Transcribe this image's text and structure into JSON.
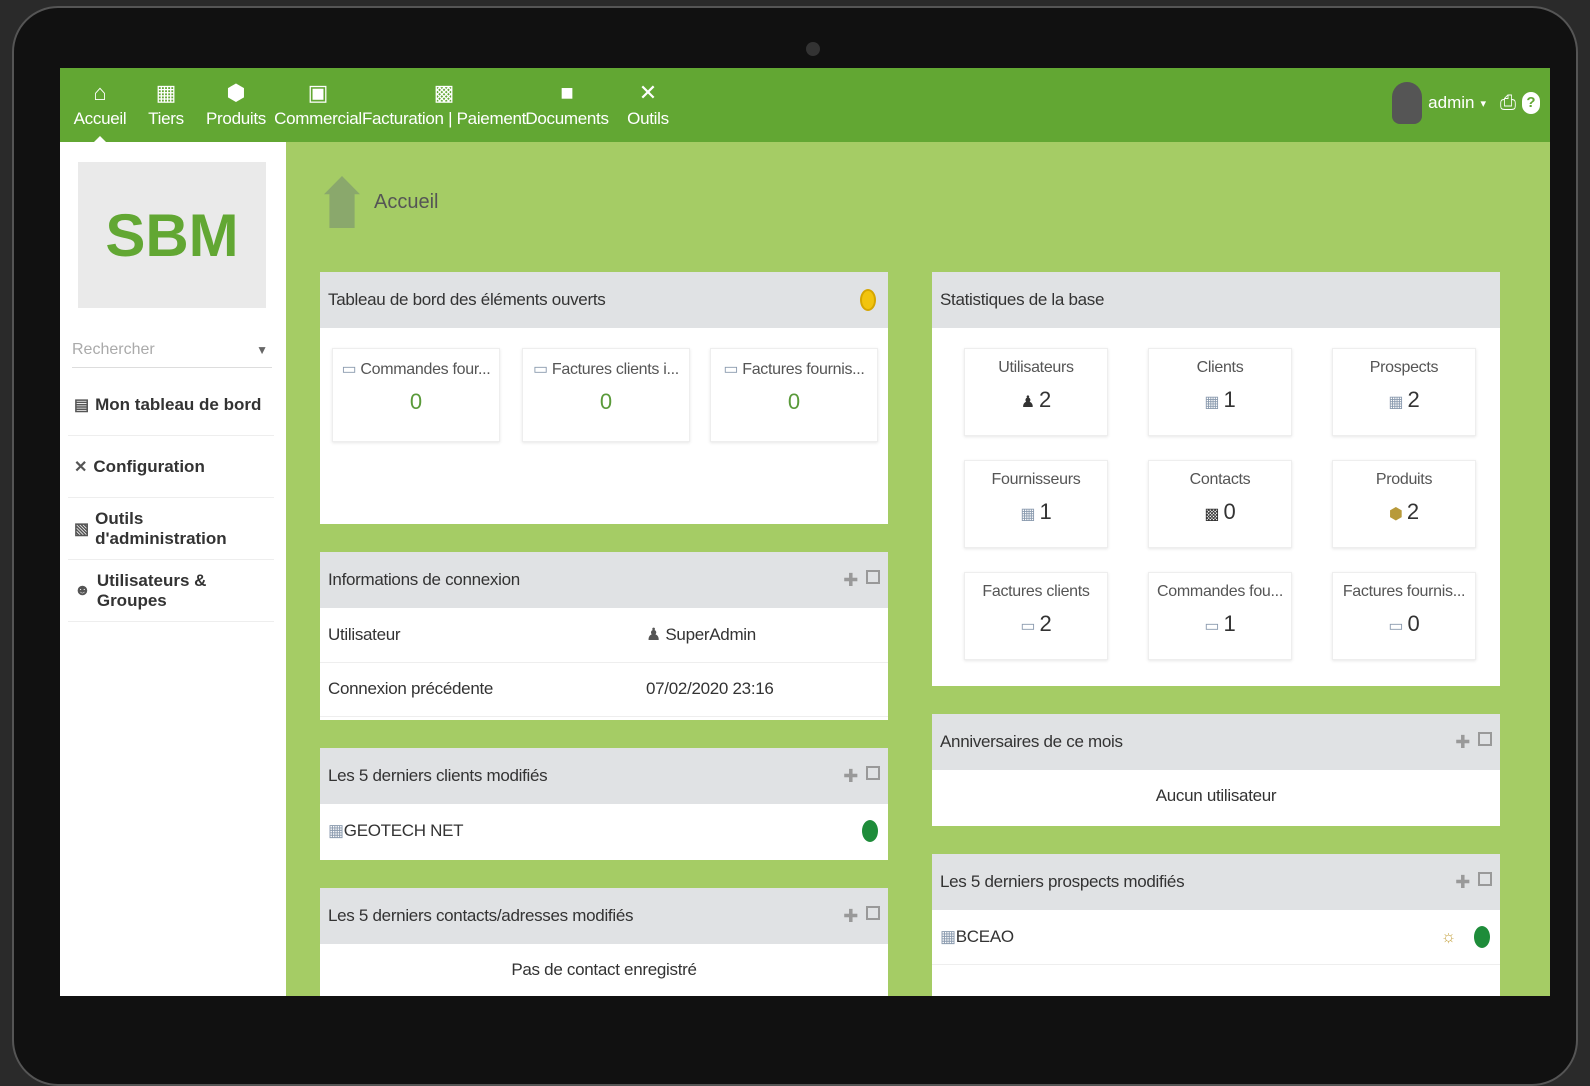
{
  "logo_text": "SBM",
  "nav": [
    {
      "label": "Accueil",
      "icon": "home-icon"
    },
    {
      "label": "Tiers",
      "icon": "building-icon"
    },
    {
      "label": "Produits",
      "icon": "cube-icon"
    },
    {
      "label": "Commercial",
      "icon": "briefcase-icon"
    },
    {
      "label": "Facturation | Paiement",
      "icon": "money-icon"
    },
    {
      "label": "Documents",
      "icon": "folder-icon"
    },
    {
      "label": "Outils",
      "icon": "wrench-icon"
    }
  ],
  "user": {
    "name": "admin"
  },
  "search": {
    "placeholder": "Rechercher"
  },
  "sidebar": [
    {
      "label": "Mon tableau de bord",
      "icon": "chart-icon"
    },
    {
      "label": "Configuration",
      "icon": "wrench-icon"
    },
    {
      "label": "Outils d'administration",
      "icon": "server-icon"
    },
    {
      "label": "Utilisateurs & Groupes",
      "icon": "users-icon"
    }
  ],
  "page_title": "Accueil",
  "dashboard": {
    "title": "Tableau de bord des éléments ouverts",
    "boxes": [
      {
        "label": "Commandes four...",
        "value": "0"
      },
      {
        "label": "Factures clients i...",
        "value": "0"
      },
      {
        "label": "Factures fournis...",
        "value": "0"
      }
    ]
  },
  "login_info": {
    "title": "Informations de connexion",
    "rows": [
      {
        "label": "Utilisateur",
        "value": "SuperAdmin"
      },
      {
        "label": "Connexion précédente",
        "value": "07/02/2020 23:16"
      }
    ]
  },
  "last_clients": {
    "title": "Les 5 derniers clients modifiés",
    "items": [
      "GEOTECH NET"
    ]
  },
  "last_contacts": {
    "title": "Les 5 derniers contacts/adresses modifiés",
    "empty": "Pas de contact enregistré"
  },
  "stats": {
    "title": "Statistiques de la base",
    "boxes": [
      {
        "label": "Utilisateurs",
        "value": "2"
      },
      {
        "label": "Clients",
        "value": "1"
      },
      {
        "label": "Prospects",
        "value": "2"
      },
      {
        "label": "Fournisseurs",
        "value": "1"
      },
      {
        "label": "Contacts",
        "value": "0"
      },
      {
        "label": "Produits",
        "value": "2"
      },
      {
        "label": "Factures clients",
        "value": "2"
      },
      {
        "label": "Commandes fou...",
        "value": "1"
      },
      {
        "label": "Factures fournis...",
        "value": "0"
      }
    ]
  },
  "birthdays": {
    "title": "Anniversaires de ce mois",
    "empty": "Aucun utilisateur"
  },
  "last_prospects": {
    "title": "Les 5 derniers prospects modifiés",
    "items": [
      "BCEAO"
    ]
  }
}
